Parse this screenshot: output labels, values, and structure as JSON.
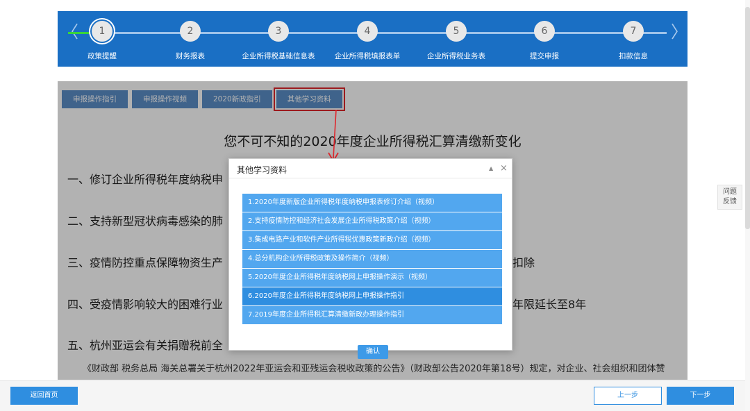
{
  "stepper": {
    "steps": [
      {
        "number": "1",
        "label": "政策提醒"
      },
      {
        "number": "2",
        "label": "财务报表"
      },
      {
        "number": "3",
        "label": "企业所得税基础信息表"
      },
      {
        "number": "4",
        "label": "企业所得税填报表单"
      },
      {
        "number": "5",
        "label": "企业所得税业务表"
      },
      {
        "number": "6",
        "label": "提交申报"
      },
      {
        "number": "7",
        "label": "扣款信息"
      }
    ],
    "left_arrow": "〈",
    "right_arrow": "〉"
  },
  "tabs": [
    {
      "label": "申报操作指引"
    },
    {
      "label": "申报操作视频"
    },
    {
      "label": "2020新政指引"
    },
    {
      "label": "其他学习资料"
    }
  ],
  "document": {
    "title": "您不可不知的2020年度企业所得税汇算清缴新变化",
    "lines": [
      "一、修订企业所得税年度纳税申",
      "二、支持新型冠状病毒感染的肺",
      "三、疫情防控重点保障物资生产",
      "四、受疫情影响较大的困难行业",
      "五、杭州亚运会有关捐赠税前全"
    ],
    "line_tails": [
      "扣除",
      "年限延长至8年"
    ],
    "paragraph": "《财政部 税务总局 海关总署关于杭州2022年亚运会和亚残运会税收政策的公告》（财政部公告2020年第18号）规定，对企业、社会组织和团体赞"
  },
  "modal": {
    "title": "其他学习资料",
    "collapse_icon": "▲",
    "close_icon": "×",
    "items": [
      "1.2020年度新版企业所得税年度纳税申报表修订介绍（视频）",
      "2.支持疫情防控和经济社会发展企业所得税政策介绍（视频）",
      "3.集成电路产业和软件产业所得税优惠政策新政介绍（视频）",
      "4.总分机构企业所得税政策及操作简介（视频）",
      "5.2020年度企业所得税年度纳税网上申报操作演示（视频）",
      "6.2020年度企业所得税年度纳税网上申报操作指引",
      "7.2019年度企业所得税汇算清缴新政办理操作指引"
    ],
    "confirm_label": "确认"
  },
  "feedback": {
    "line1": "问题",
    "line2": "反馈"
  },
  "bottombar": {
    "home_label": "返回首页",
    "prev_label": "上一步",
    "next_label": "下一步"
  },
  "colors": {
    "header_blue": "#1a6fc4",
    "progress_green": "#39d43c",
    "tab_blue": "#5b8ec8",
    "highlight_red": "#e0262c",
    "list_blue": "#52a7ef",
    "button_blue": "#2f8ee0"
  }
}
